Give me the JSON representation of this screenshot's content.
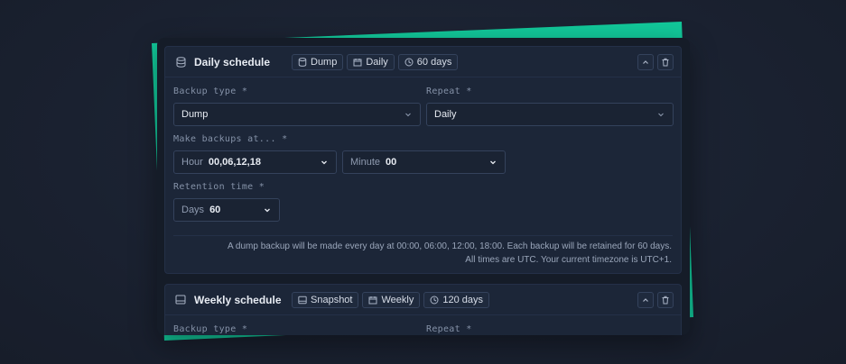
{
  "colors": {
    "accent": "#12c89a",
    "card": "#1c2638",
    "panel": "#151c28"
  },
  "schedules": [
    {
      "title": "Daily schedule",
      "icon": "database-icon",
      "chips": [
        {
          "icon": "database-icon",
          "label": "Dump"
        },
        {
          "icon": "calendar-icon",
          "label": "Daily"
        },
        {
          "icon": "clock-icon",
          "label": "60 days"
        }
      ],
      "fields": {
        "backup_type_label": "Backup type *",
        "backup_type_value": "Dump",
        "repeat_label": "Repeat *",
        "repeat_value": "Daily",
        "make_backups_label": "Make backups at... *",
        "hour_prefix": "Hour",
        "hour_value": "00,06,12,18",
        "minute_prefix": "Minute",
        "minute_value": "00",
        "retention_label": "Retention time *",
        "days_prefix": "Days",
        "days_value": "60"
      },
      "note_line1": "A dump backup will be made every day at 00:00, 06:00, 12:00, 18:00. Each backup will be retained for 60 days.",
      "note_line2": "All times are UTC. Your current timezone is UTC+1."
    },
    {
      "title": "Weekly schedule",
      "icon": "drive-icon",
      "chips": [
        {
          "icon": "drive-icon",
          "label": "Snapshot"
        },
        {
          "icon": "calendar-icon",
          "label": "Weekly"
        },
        {
          "icon": "clock-icon",
          "label": "120 days"
        }
      ],
      "fields": {
        "backup_type_label": "Backup type *",
        "repeat_label": "Repeat *"
      }
    }
  ]
}
